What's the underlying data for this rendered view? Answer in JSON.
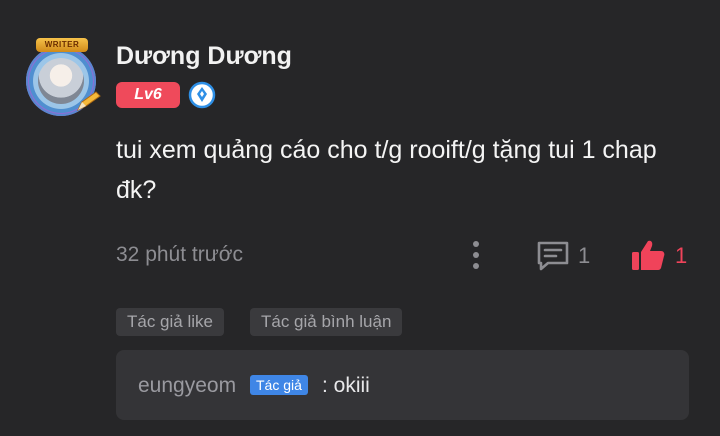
{
  "comment": {
    "avatar_badge": "WRITER",
    "username": "Dương Dương",
    "level": "Lv6",
    "content": "tui xem quảng cáo cho t/g rooift/g tặng tui 1 chap đk?",
    "time": "32 phút trước",
    "reply_count": "1",
    "like_count": "1",
    "tags": [
      "Tác giả like",
      "Tác giả bình luận"
    ],
    "reply": {
      "user": "eungyeom",
      "badge": "Tác giả",
      "text": ": okiii"
    }
  },
  "colors": {
    "background": "#262628",
    "level_badge": "#ef4a5b",
    "like_active": "#f0435a",
    "author_badge": "#3f86e6",
    "muted_text": "#8d8d92"
  },
  "icons": [
    "more-vertical-icon",
    "comment-icon",
    "like-icon",
    "rank-diamond-icon",
    "pencil-icon"
  ]
}
